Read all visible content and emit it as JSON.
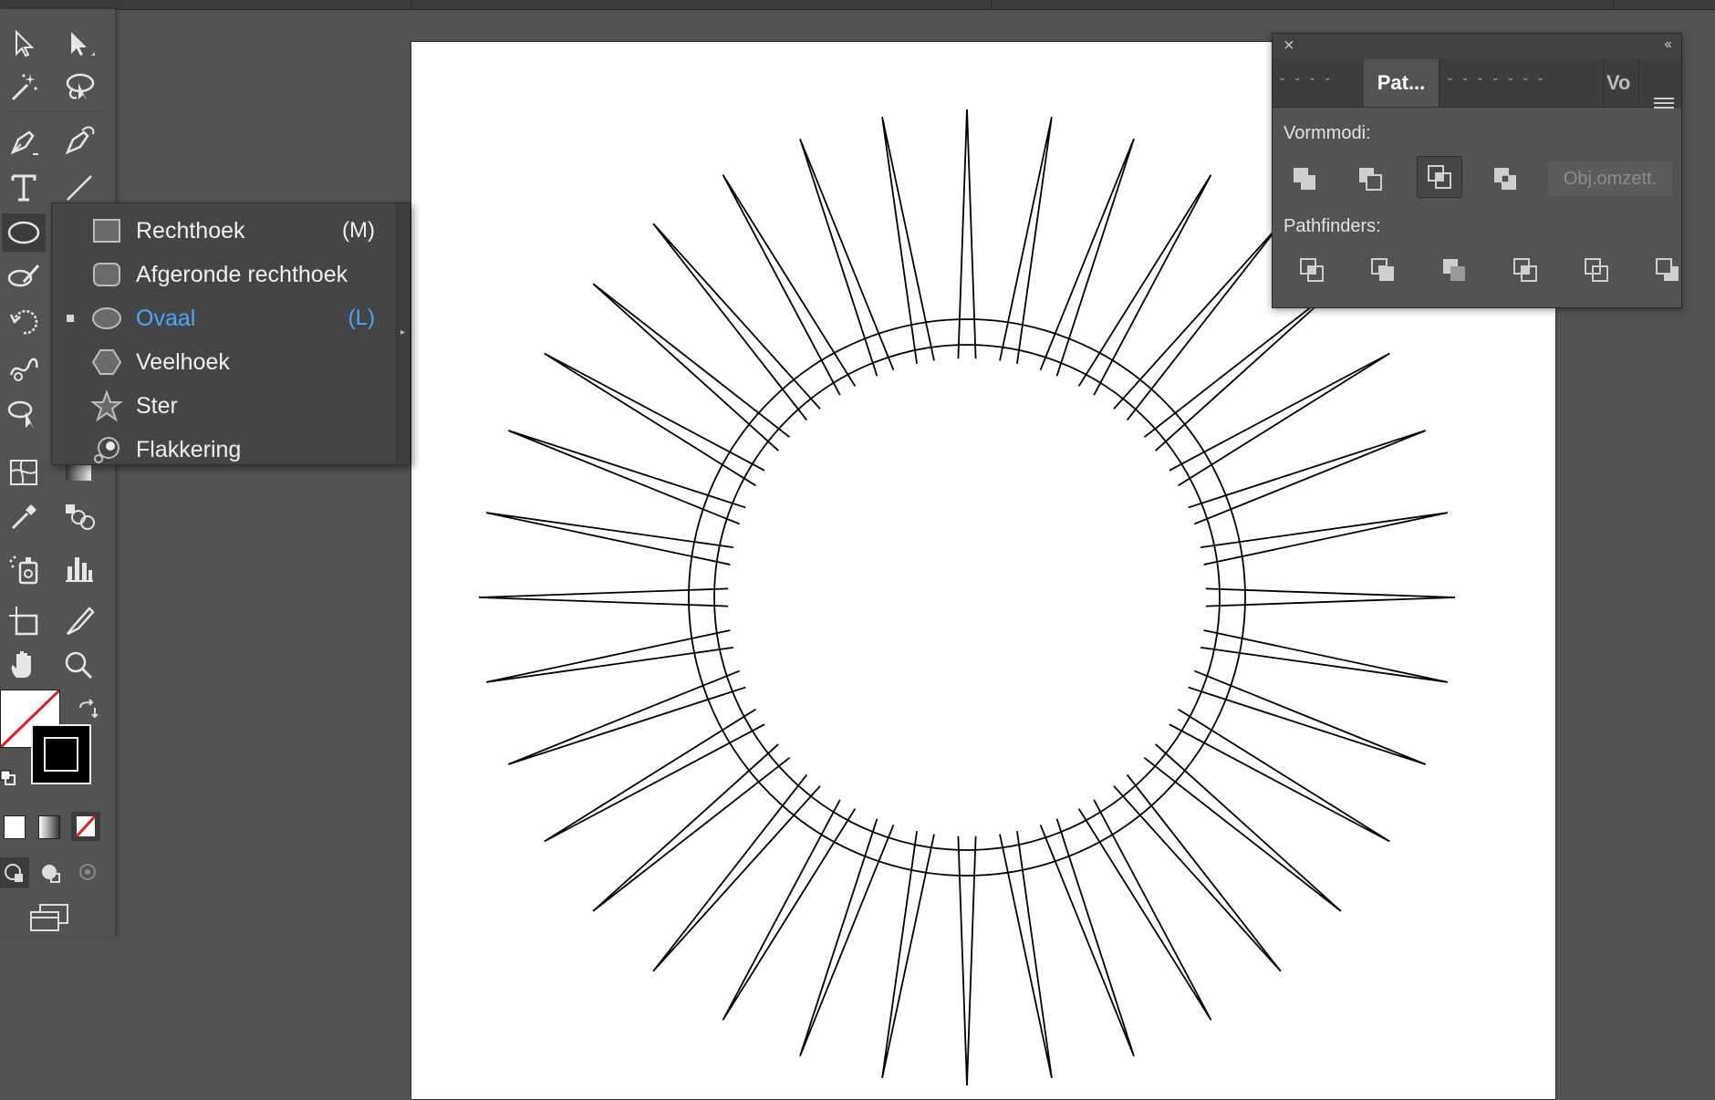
{
  "flyout": {
    "items": [
      {
        "label": "Rechthoek",
        "shortcut": "(M)"
      },
      {
        "label": "Afgeronde rechthoek",
        "shortcut": ""
      },
      {
        "label": "Ovaal",
        "shortcut": "(L)"
      },
      {
        "label": "Veelhoek",
        "shortcut": ""
      },
      {
        "label": "Ster",
        "shortcut": ""
      },
      {
        "label": "Flakkering",
        "shortcut": ""
      }
    ],
    "selected": "Ovaal"
  },
  "pathfinder_panel": {
    "close_glyph": "×",
    "collapse_glyph": "‹‹",
    "tabs": [
      {
        "label": "Pat..."
      },
      {
        "label": "Vo"
      }
    ],
    "shape_modes_label": "Vormmodi:",
    "expand_button": "Obj.omzett.",
    "pathfinders_label": "Pathfinders:"
  },
  "colors": {
    "ui_background": "#535353",
    "artboard": "#ffffff",
    "selected_item": "#4aa6ff",
    "no_fill_slash": "#e01e24"
  },
  "artwork": {
    "shape": "starburst",
    "spike_count": 36,
    "rings": 2
  }
}
